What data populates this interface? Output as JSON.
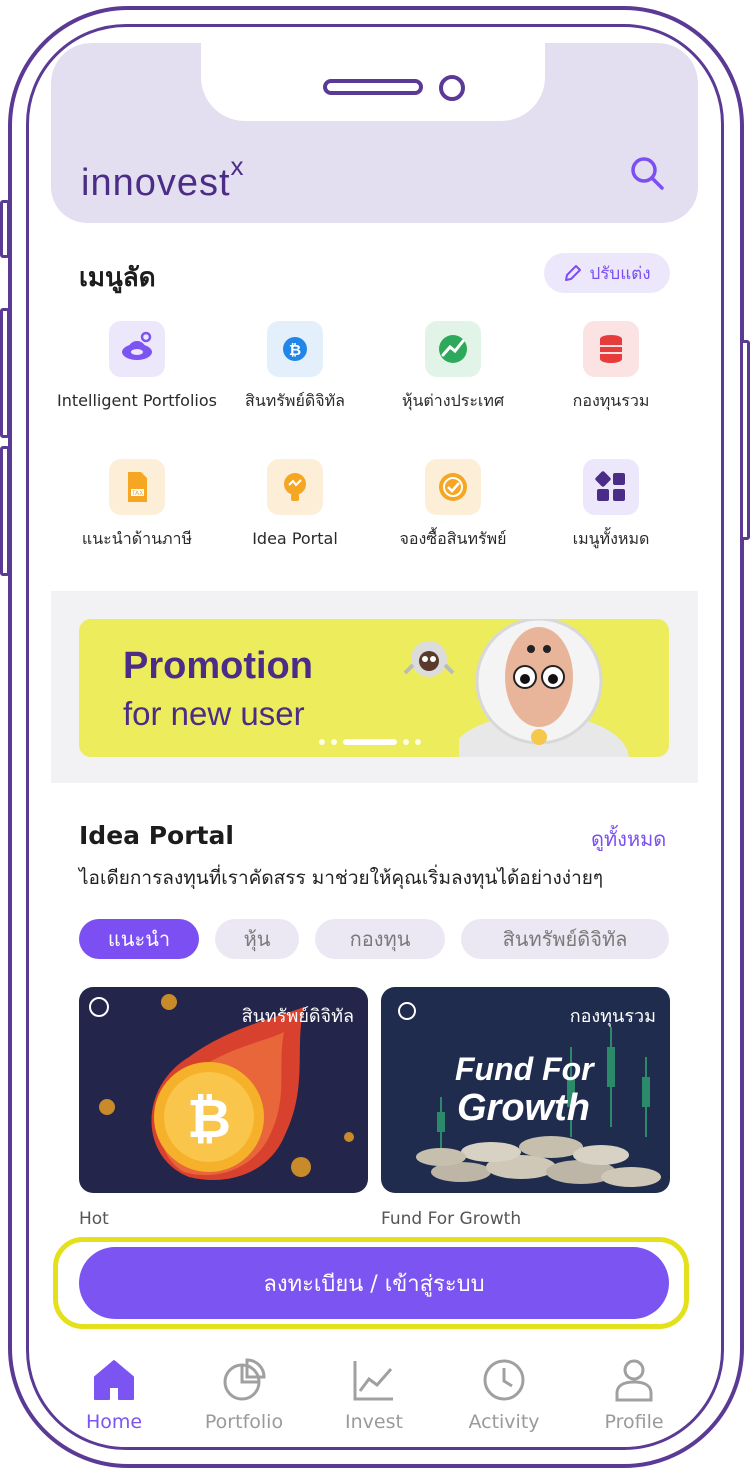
{
  "header": {
    "logo_text": "innovest",
    "logo_sup": "x"
  },
  "quick_menu": {
    "title": "เมนูลัด",
    "edit_label": "ปรับแต่ง",
    "items": [
      {
        "label": "Intelligent Portfolios",
        "icon": "planet-icon"
      },
      {
        "label": "สินทรัพย์ดิจิทัล",
        "icon": "bitcoin-icon"
      },
      {
        "label": "หุ้นต่างประเทศ",
        "icon": "foreign-stock-icon"
      },
      {
        "label": "กองทุนรวม",
        "icon": "fund-stack-icon"
      },
      {
        "label": "แนะนำด้านภาษี",
        "icon": "tax-doc-icon"
      },
      {
        "label": "Idea Portal",
        "icon": "lightbulb-icon"
      },
      {
        "label": "จองซื้อสินทรัพย์",
        "icon": "badge-check-icon"
      },
      {
        "label": "เมนูทั้งหมด",
        "icon": "grid-icon"
      }
    ]
  },
  "banner": {
    "line1": "Promotion",
    "line2": "for new user",
    "slides": 5,
    "active_slide": 2
  },
  "idea_portal": {
    "title": "Idea Portal",
    "see_all": "ดูทั้งหมด",
    "subtitle": "ไอเดียการลงทุนที่เราคัดสรร มาช่วยให้คุณเริ่มลงทุนได้อย่างง่ายๆ",
    "chips": [
      "แนะนำ",
      "หุ้น",
      "กองทุน",
      "สินทรัพย์ดิจิทัล"
    ],
    "cards": [
      {
        "tag": "สินทรัพย์ดิจิทัล",
        "caption": "Hot"
      },
      {
        "tag": "กองทุนรวม",
        "caption": "Fund For Growth",
        "art_line1": "Fund For",
        "art_line2": "Growth"
      }
    ]
  },
  "cta": {
    "label": "ลงทะเบียน / เข้าสู่ระบบ"
  },
  "bottom_nav": {
    "items": [
      "Home",
      "Portfolio",
      "Invest",
      "Activity",
      "Profile"
    ],
    "active": "Home"
  },
  "colors": {
    "brand": "#4b2c86",
    "accent": "#7b54f2",
    "highlight": "#e4e01c",
    "banner": "#ecec5c"
  }
}
